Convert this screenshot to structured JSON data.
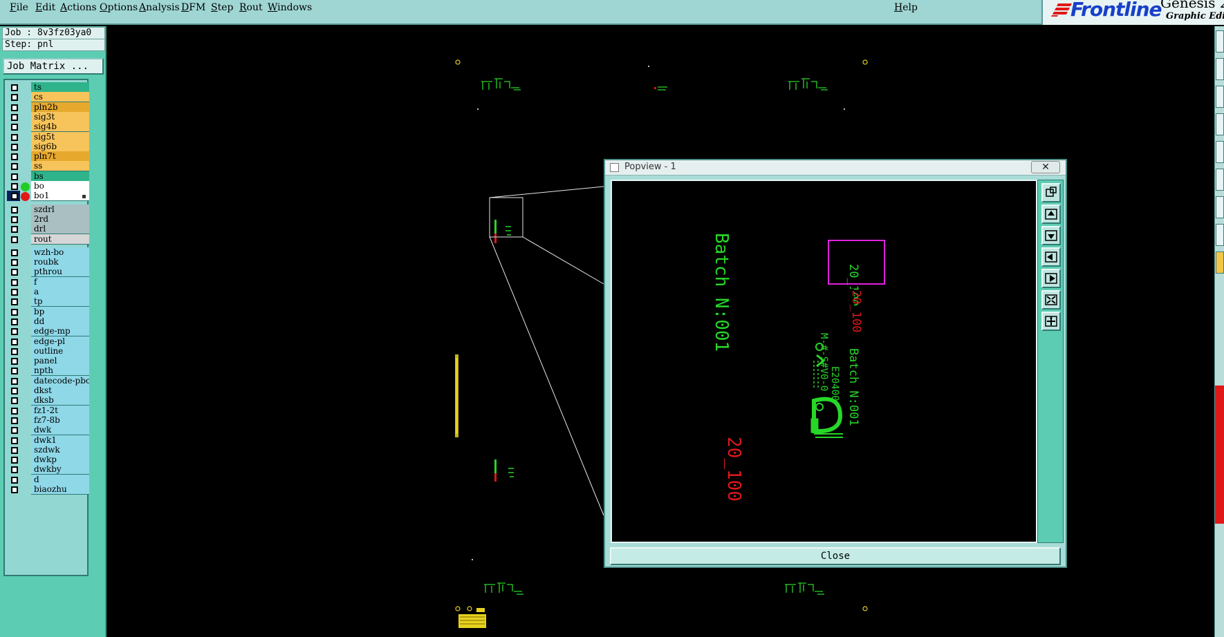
{
  "menubar": {
    "items": [
      "File",
      "Edit",
      "Actions",
      "Options",
      "Analysis",
      "DFM",
      "Step",
      "Rout",
      "Windows"
    ],
    "help": "Help"
  },
  "logo": {
    "brand": "Frontline",
    "product": "Genesis 2",
    "subtitle": "Graphic Edi"
  },
  "sidebar": {
    "job": "Job : 8v3fz03ya0",
    "step": "Step: pnl",
    "job_matrix_button": "Job Matrix ...",
    "layers": [
      {
        "name": "ts",
        "color": "#2fb38a"
      },
      {
        "name": "cs",
        "color": "#f6c45a"
      },
      {
        "name": "pln2b",
        "color": "#e6a92e"
      },
      {
        "name": "sig3t",
        "color": "#f6c45a"
      },
      {
        "name": "sig4b",
        "color": "#f6c45a"
      },
      {
        "name": "sig5t",
        "color": "#f6c45a"
      },
      {
        "name": "sig6b",
        "color": "#f6c45a"
      },
      {
        "name": "pln7t",
        "color": "#e6a92e"
      },
      {
        "name": "ss",
        "color": "#f6c45a"
      },
      {
        "name": "bs",
        "color": "#2fb38a"
      },
      {
        "name": "bo",
        "color": "#ffffff",
        "dot": "#22cc22"
      },
      {
        "name": "bo1",
        "color": "#ffffff",
        "dot": "#e01818",
        "selected": true
      },
      {
        "name": "szdrl",
        "color": "#a9bfc2"
      },
      {
        "name": "2rd",
        "color": "#a9bfc2"
      },
      {
        "name": "drl",
        "color": "#a9bfc2"
      },
      {
        "name": "rout",
        "color": "#d6d6d6"
      },
      {
        "name": "wzh-bo",
        "color": "#8fd8e8"
      },
      {
        "name": "roubk",
        "color": "#8fd8e8"
      },
      {
        "name": "pthrou",
        "color": "#8fd8e8"
      },
      {
        "name": "f",
        "color": "#8fd8e8"
      },
      {
        "name": "a",
        "color": "#8fd8e8"
      },
      {
        "name": "tp",
        "color": "#8fd8e8"
      },
      {
        "name": "bp",
        "color": "#8fd8e8"
      },
      {
        "name": "dd",
        "color": "#8fd8e8"
      },
      {
        "name": "edge-mp",
        "color": "#8fd8e8"
      },
      {
        "name": "edge-pl",
        "color": "#8fd8e8"
      },
      {
        "name": "outline",
        "color": "#8fd8e8"
      },
      {
        "name": "panel",
        "color": "#8fd8e8"
      },
      {
        "name": "npth",
        "color": "#8fd8e8"
      },
      {
        "name": "datecode-pbc",
        "color": "#8fd8e8"
      },
      {
        "name": "dkst",
        "color": "#8fd8e8"
      },
      {
        "name": "dksb",
        "color": "#8fd8e8"
      },
      {
        "name": "fz1-2t",
        "color": "#8fd8e8"
      },
      {
        "name": "fz7-8b",
        "color": "#8fd8e8"
      },
      {
        "name": "dwk",
        "color": "#8fd8e8"
      },
      {
        "name": "dwk1",
        "color": "#8fd8e8"
      },
      {
        "name": "szdwk",
        "color": "#8fd8e8"
      },
      {
        "name": "dwkp",
        "color": "#8fd8e8"
      },
      {
        "name": "dwkby",
        "color": "#8fd8e8"
      },
      {
        "name": "d",
        "color": "#8fd8e8"
      },
      {
        "name": "biaozhu",
        "color": "#8fd8e8"
      }
    ]
  },
  "popview": {
    "title": "Popview - 1",
    "close_x": "✕",
    "close_button": "Close",
    "texts": {
      "batch_large": "Batch N:001",
      "date_large": "20_100",
      "batch_small": "Batch N:001",
      "date_small": "20_100",
      "id_small": "E20400",
      "part_small": "M-#-S#V0-0"
    },
    "tools": [
      "zoom-window-icon",
      "pan-up-icon",
      "pan-down-icon",
      "pan-left-icon",
      "pan-right-icon",
      "zoom-fit-icon",
      "zoom-home-icon"
    ]
  }
}
